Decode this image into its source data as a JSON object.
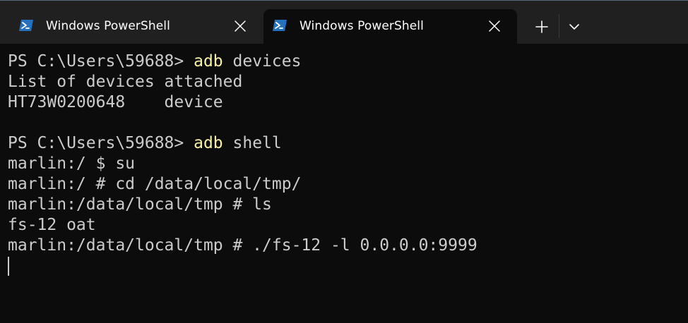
{
  "tabs": [
    {
      "title": "Windows PowerShell",
      "icon": "powershell-icon",
      "active": false
    },
    {
      "title": "Windows PowerShell",
      "icon": "powershell-icon",
      "active": true
    }
  ],
  "toolbar": {
    "new_tab_icon": "plus-icon",
    "dropdown_icon": "chevron-down-icon"
  },
  "colors": {
    "titlebar_bg": "#202020",
    "terminal_bg": "#0c0c0c",
    "text": "#cccccc",
    "command_highlight": "#f9f1a5",
    "powershell_icon_bg": "#2671be"
  },
  "terminal": {
    "lines": [
      {
        "prefix": "PS C:\\Users\\59688> ",
        "cmd": "adb",
        "rest": " devices"
      },
      {
        "prefix": "List of devices attached",
        "cmd": "",
        "rest": ""
      },
      {
        "prefix": "HT73W0200648    device",
        "cmd": "",
        "rest": ""
      },
      {
        "prefix": "",
        "cmd": "",
        "rest": ""
      },
      {
        "prefix": "PS C:\\Users\\59688> ",
        "cmd": "adb",
        "rest": " shell"
      },
      {
        "prefix": "marlin:/ $ su",
        "cmd": "",
        "rest": ""
      },
      {
        "prefix": "marlin:/ # cd /data/local/tmp/",
        "cmd": "",
        "rest": ""
      },
      {
        "prefix": "marlin:/data/local/tmp # ls",
        "cmd": "",
        "rest": ""
      },
      {
        "prefix": "fs-12 oat",
        "cmd": "",
        "rest": ""
      },
      {
        "prefix": "marlin:/data/local/tmp # ./fs-12 -l 0.0.0.0:9999",
        "cmd": "",
        "rest": ""
      }
    ]
  }
}
